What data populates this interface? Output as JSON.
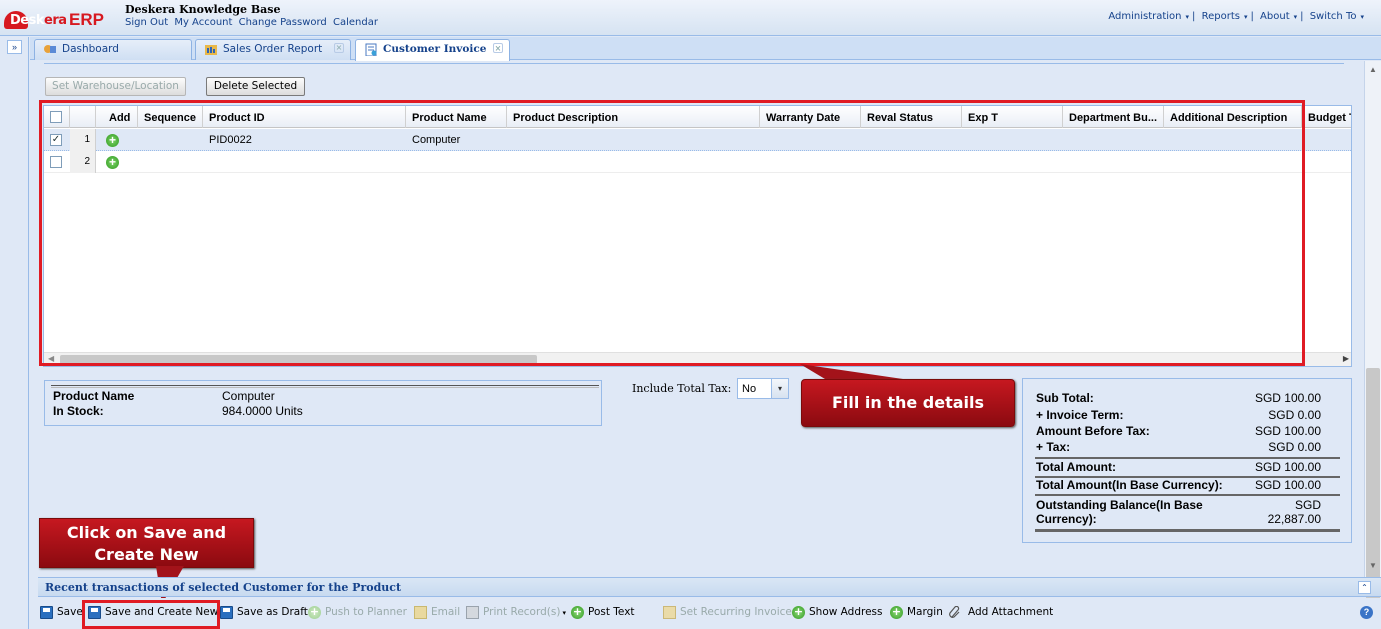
{
  "app": {
    "logo_text_dark": "Desk",
    "logo_text_red": "era",
    "logo_erp": "ERP",
    "title": "Deskera Knowledge Base",
    "links": [
      "Sign Out",
      "My Account",
      "Change Password",
      "Calendar"
    ],
    "menu": [
      "Administration",
      "Reports",
      "About",
      "Switch To"
    ],
    "menu_caret": "▾",
    "menu_sep": "|",
    "expand_icon": "»"
  },
  "tabs": [
    {
      "label": "Dashboard",
      "icon": "dashboard-icon",
      "closable": false
    },
    {
      "label": "Sales Order Report",
      "icon": "report-icon",
      "closable": true
    },
    {
      "label": "Customer Invoice",
      "icon": "invoice-icon",
      "closable": true,
      "active": true
    }
  ],
  "tab_close": "×",
  "toolbar": {
    "set_warehouse": "Set Warehouse/Location",
    "delete_selected": "Delete Selected"
  },
  "grid": {
    "columns": [
      "Add",
      "Sequence",
      "Product ID",
      "Product Name",
      "Product Description",
      "Warranty Date",
      "Reval Status",
      "Exp T",
      "Department Bu...",
      "Additional Description",
      "Budget T"
    ],
    "rows": [
      {
        "num": "1",
        "checked": true,
        "check_mark": "✓",
        "product_id": "PID0022",
        "product_name": "Computer"
      },
      {
        "num": "2",
        "checked": false,
        "check_mark": "",
        "product_id": "",
        "product_name": ""
      }
    ],
    "add_icon": "+"
  },
  "product_info": {
    "name_label": "Product Name",
    "name_value": "Computer",
    "stock_label": "In Stock:",
    "stock_value": "984.0000 Units"
  },
  "tax": {
    "label": "Include Total Tax:",
    "value": "No",
    "dropdown_icon": "▾"
  },
  "summary": {
    "sub_total_label": "Sub Total:",
    "sub_total_value": "SGD 100.00",
    "invoice_term_label": "+ Invoice Term:",
    "invoice_term_value": "SGD 0.00",
    "amount_before_tax_label": "Amount Before Tax:",
    "amount_before_tax_value": "SGD 100.00",
    "tax_label": "+ Tax:",
    "tax_value": "SGD 0.00",
    "total_label": "Total Amount:",
    "total_value": "SGD 100.00",
    "total_base_label": "Total Amount(In Base Currency):",
    "total_base_value": "SGD 100.00",
    "outstanding_label_1": "Outstanding Balance(In Base",
    "outstanding_label_2": "Currency):",
    "outstanding_value_1": "SGD",
    "outstanding_value_2": "22,887.00"
  },
  "callouts": {
    "fill_details": "Fill in the details",
    "save_create_1": "Click on Save and",
    "save_create_2": "Create New"
  },
  "recent": {
    "title": "Recent transactions of selected Customer for the Product",
    "collapse_icon": "⌃"
  },
  "bottom": {
    "save": "Save",
    "save_create_new": "Save and Create New",
    "save_draft": "Save as Draft",
    "push_planner": "Push to Planner",
    "email": "Email",
    "print": "Print Record(s)",
    "print_caret": "▾",
    "post_text": "Post Text",
    "recurring": "Set Recurring Invoice",
    "show_address": "Show Address",
    "margin": "Margin",
    "attachment": "Add Attachment",
    "help_icon": "?"
  },
  "colors": {
    "accent": "#15428b",
    "highlight_red": "#e01b24",
    "callout": "#b01219",
    "panel_bg": "#dfe8f6"
  }
}
